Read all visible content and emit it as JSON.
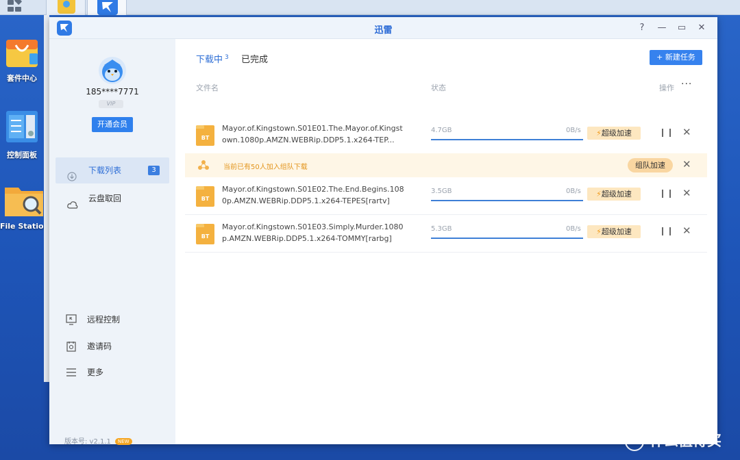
{
  "desktop": {
    "icons": [
      {
        "label": "套件中心"
      },
      {
        "label": "控制面板"
      },
      {
        "label": "File Station"
      }
    ]
  },
  "window": {
    "title": "迅雷",
    "controls": {
      "help": "?",
      "minimize": "—",
      "maximize": "▭",
      "close": "✕"
    }
  },
  "sidebar": {
    "username": "185****7771",
    "vip_tag": "VIP",
    "open_vip": "开通会员",
    "nav": [
      {
        "label": "下载列表",
        "badge": "3"
      },
      {
        "label": "云盘取回"
      }
    ],
    "bottom": [
      {
        "label": "远程控制"
      },
      {
        "label": "邀请码"
      },
      {
        "label": "更多"
      }
    ],
    "version": "版本号: v2.1.1",
    "version_badge": "NEW"
  },
  "tabs": {
    "downloading": "下载中",
    "downloading_count": "3",
    "completed": "已完成"
  },
  "new_task_button": "新建任务",
  "columns": {
    "filename": "文件名",
    "status": "状态",
    "action": "操作",
    "more": "···"
  },
  "team_banner": {
    "message": "当前已有50人加入组队下载",
    "button": "组队加速"
  },
  "tasks": [
    {
      "filename": "Mayor.of.Kingstown.S01E01.The.Mayor.of.Kingstown.1080p.AMZN.WEBRip.DDP5.1.x264-TEP...",
      "size": "4.7GB",
      "speed": "0B/s",
      "boost": "超级加速",
      "progress": 1.0
    },
    {
      "filename": "Mayor.of.Kingstown.S01E02.The.End.Begins.1080p.AMZN.WEBRip.DDP5.1.x264-TEPES[rartv]",
      "size": "3.5GB",
      "speed": "0B/s",
      "boost": "超级加速",
      "progress": 1.0
    },
    {
      "filename": "Mayor.of.Kingstown.S01E03.Simply.Murder.1080p.AMZN.WEBRip.DDP5.1.x264-TOMMY[rarbg]",
      "size": "5.3GB",
      "speed": "0B/s",
      "boost": "超级加速",
      "progress": 1.0
    }
  ],
  "file_icon_text": "BT",
  "watermark": "什么值得买",
  "colors": {
    "accent": "#2f80ed",
    "boost_bg": "#fde7c0",
    "banner_bg": "#fef6e6",
    "banner_text": "#e3951d"
  }
}
